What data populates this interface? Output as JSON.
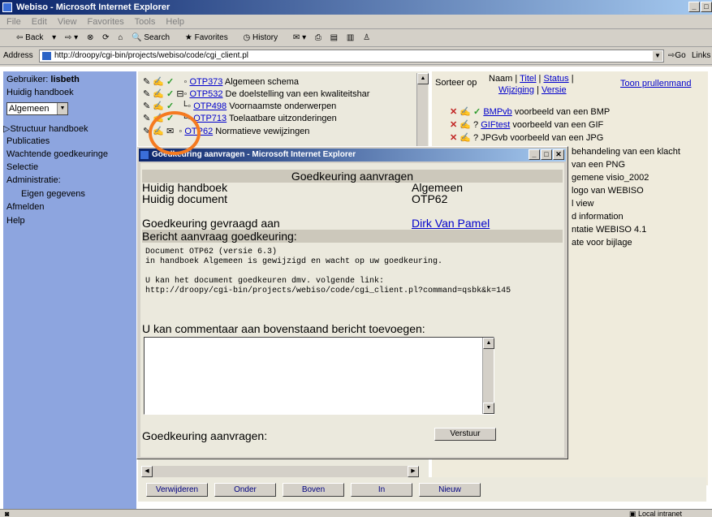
{
  "window": {
    "title": "Webiso - Microsoft Internet Explorer"
  },
  "menu": [
    "File",
    "Edit",
    "View",
    "Favorites",
    "Tools",
    "Help"
  ],
  "toolbar": {
    "back": "Back",
    "search": "Search",
    "favorites": "Favorites",
    "history": "History"
  },
  "address": {
    "label": "Address",
    "url": "http://droopy/cgi-bin/projects/webiso/code/cgi_client.pl",
    "go": "Go",
    "links": "Links"
  },
  "left": {
    "user_label": "Gebruiker:",
    "user_name": "lisbeth",
    "handbook_label": "Huidig handboek",
    "handbook_select": "Algemeen",
    "items": [
      "Structuur handboek",
      "Publicaties",
      "Wachtende goedkeuringe",
      "Selectie",
      "Administratie:",
      "Eigen gegevens",
      "Afmelden",
      "Help"
    ]
  },
  "tree": [
    {
      "code": "OTP373",
      "title": "Algemeen schema"
    },
    {
      "code": "OTP532",
      "title": "De doelstelling van een kwaliteitshar"
    },
    {
      "code": "OTP498",
      "title": "Voornaamste onderwerpen"
    },
    {
      "code": "OTP713",
      "title": "Toelaatbare uitzonderingen"
    },
    {
      "code": "OTP62",
      "title": "Normatieve vewijzingen"
    }
  ],
  "right": {
    "sort_label": "Sorteer op",
    "sort_naam": "Naam",
    "sort_titel": "Titel",
    "sort_status": "Status",
    "sort_wijziging": "Wijziging",
    "sort_versie": "Versie",
    "trash_link": "Toon prullenmand",
    "files": [
      {
        "name": "BMPvb",
        "desc": "voorbeeld van een BMP"
      },
      {
        "name": "GIFtest",
        "desc": "voorbeeld van een GIF"
      },
      {
        "name": "JPGvb",
        "desc": "voorbeeld van een JPG"
      }
    ],
    "partial": [
      "behandeling van een klacht",
      "van een PNG",
      "gemene visio_2002",
      "logo van WEBISO",
      "l view",
      "d information",
      "ntatie WEBISO 4.1",
      "ate voor bijlage"
    ]
  },
  "buttons": [
    "Verwijderen",
    "Onder",
    "Boven",
    "In",
    "Nieuw"
  ],
  "popup": {
    "title": "Goedkeuring aanvragen - Microsoft Internet Explorer",
    "heading": "Goedkeuring aanvragen",
    "handbook_label": "Huidig handboek",
    "handbook_value": "Algemeen",
    "document_label": "Huidig document",
    "document_value": "OTP62",
    "requested_label": "Goedkeuring gevraagd aan",
    "requested_value": "Dirk Van Pamel",
    "message_label": "Bericht aanvraag goedkeuring:",
    "message": "Document OTP62 (versie 6.3)\nin handboek Algemeen is gewijzigd en wacht op uw goedkeuring.\n\nU kan het document goedkeuren dmv. volgende link:\nhttp://droopy/cgi-bin/projects/webiso/code/cgi_client.pl?command=qsbk&k=145",
    "comment_label": "U kan commentaar aan bovenstaand bericht toevoegen:",
    "comment_value": "",
    "submit_label": "Goedkeuring aanvragen:",
    "submit_button": "Verstuur"
  },
  "status": {
    "zone": "Local intranet"
  },
  "colors": {
    "highlight": "#f57a20",
    "link": "#0000cc",
    "check": "#2a9a2a",
    "cross": "#c02020"
  }
}
